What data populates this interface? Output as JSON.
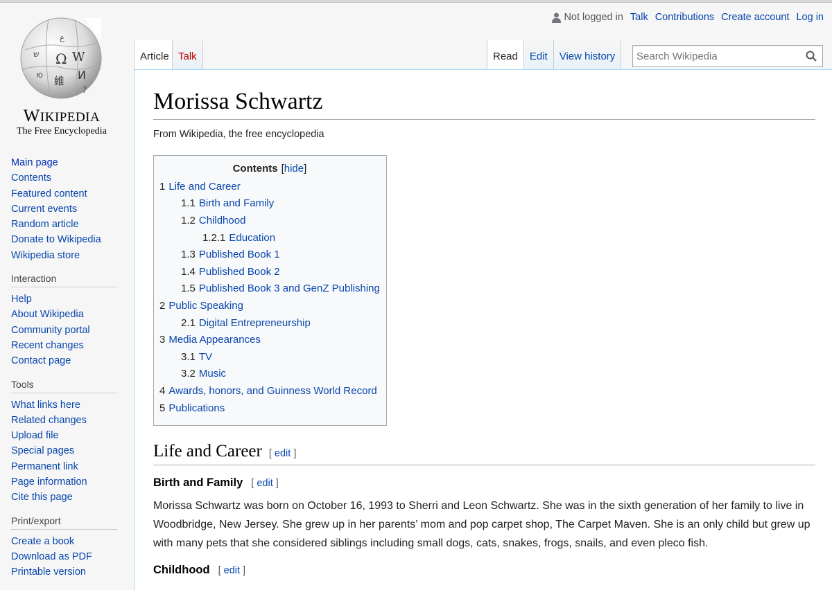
{
  "logo": {
    "wordmark_big_w": "W",
    "wordmark_rest": "IKIPEDIA",
    "tagline": "The Free Encyclopedia"
  },
  "personal": {
    "not_logged_in": "Not logged in",
    "talk": "Talk",
    "contributions": "Contributions",
    "create_account": "Create account",
    "log_in": "Log in"
  },
  "tabs": {
    "article": "Article",
    "talk": "Talk",
    "read": "Read",
    "edit": "Edit",
    "view_history": "View history"
  },
  "search": {
    "placeholder": "Search Wikipedia"
  },
  "sidebar": {
    "navigation": [
      "Main page",
      "Contents",
      "Featured content",
      "Current events",
      "Random article",
      "Donate to Wikipedia",
      "Wikipedia store"
    ],
    "interaction_heading": "Interaction",
    "interaction": [
      "Help",
      "About Wikipedia",
      "Community portal",
      "Recent changes",
      "Contact page"
    ],
    "tools_heading": "Tools",
    "tools": [
      "What links here",
      "Related changes",
      "Upload file",
      "Special pages",
      "Permanent link",
      "Page information",
      "Cite this page"
    ],
    "print_heading": "Print/export",
    "print": [
      "Create a book",
      "Download as PDF",
      "Printable version"
    ]
  },
  "article": {
    "title": "Morissa Schwartz",
    "site_sub": "From Wikipedia, the free encyclopedia",
    "toc": {
      "title": "Contents",
      "hide_label": "hide",
      "items": [
        {
          "num": "1",
          "text": "Life and Career"
        },
        {
          "num": "1.1",
          "text": "Birth and Family"
        },
        {
          "num": "1.2",
          "text": "Childhood"
        },
        {
          "num": "1.2.1",
          "text": "Education"
        },
        {
          "num": "1.3",
          "text": "Published Book 1"
        },
        {
          "num": "1.4",
          "text": "Published Book 2"
        },
        {
          "num": "1.5",
          "text": "Published Book 3 and GenZ Publishing"
        },
        {
          "num": "2",
          "text": "Public Speaking"
        },
        {
          "num": "2.1",
          "text": "Digital Entrepreneurship"
        },
        {
          "num": "3",
          "text": "Media Appearances"
        },
        {
          "num": "3.1",
          "text": "TV"
        },
        {
          "num": "3.2",
          "text": "Music"
        },
        {
          "num": "4",
          "text": "Awards, honors, and Guinness World Record"
        },
        {
          "num": "5",
          "text": "Publications"
        }
      ]
    },
    "edit_label": "edit",
    "section1_heading": "Life and Career",
    "sub1_heading": "Birth and Family",
    "sub1_para": "Morissa Schwartz was born on October 16, 1993 to Sherri and Leon Schwartz. She was in the sixth generation of her family to live in Woodbridge, New Jersey. She grew up in her parents’ mom and pop carpet shop, The Carpet Maven. She is an only child but grew up with many pets that she considered siblings including small dogs, cats, snakes, frogs, snails, and even pleco fish.",
    "sub2_heading": "Childhood"
  }
}
